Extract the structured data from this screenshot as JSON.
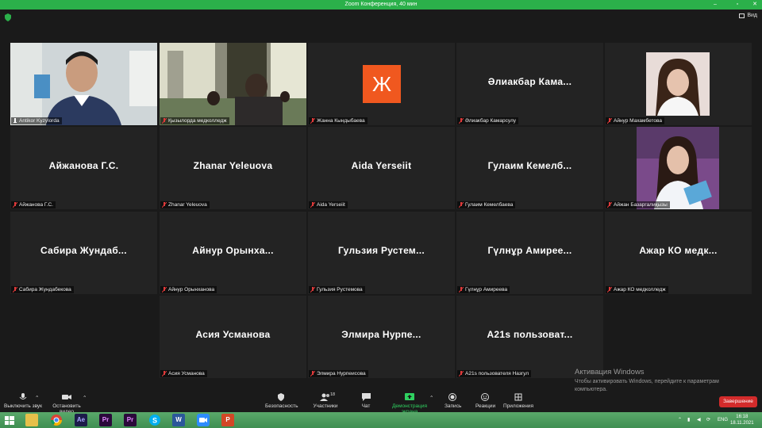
{
  "window": {
    "title": "Zoom Конференция, 40 мин",
    "view_label": "Вид"
  },
  "tiles": [
    {
      "name": "Antikor Kyzylorda",
      "big": ""
    },
    {
      "name": "Қызылорда медколледж",
      "big": ""
    },
    {
      "name": "Жанна Кындыбаева",
      "big": "",
      "logo": "Ж"
    },
    {
      "name": "Әлиакбар Камарсулу",
      "big": "Әлиакбар  Кама..."
    },
    {
      "name": "Айнур Махамбетова",
      "big": ""
    },
    {
      "name": "Айжанова Г.С.",
      "big": "Айжанова Г.С."
    },
    {
      "name": "Zhanar Yeleuova",
      "big": "Zhanar Yeleuova"
    },
    {
      "name": "Aida Yerseiit",
      "big": "Aida Yerseiit"
    },
    {
      "name": "Гулаим Кемелбаева",
      "big": "Гулаим  Кемелб..."
    },
    {
      "name": "Айжан Базаргалиқызы",
      "big": ""
    },
    {
      "name": "Сабира Жундабекова",
      "big": "Сабира  Жундаб..."
    },
    {
      "name": "Айнур Орынханова",
      "big": "Айнур  Орынха..."
    },
    {
      "name": "Гульзия Рустемова",
      "big": "Гульзия  Рустем..."
    },
    {
      "name": "Гүлнұр Амиреева",
      "big": "Гүлнұр  Амирее..."
    },
    {
      "name": "Ажар КО медколледж",
      "big": "Ажар КО  медк..."
    },
    {
      "name": "Асия Усманова",
      "big": "Асия Усманова"
    },
    {
      "name": "Элмира Нурпеисова",
      "big": "Элмира  Нурпе..."
    },
    {
      "name": "A21s пользователя Назгул",
      "big": "A21s  пользоват..."
    }
  ],
  "toolbar": {
    "mute": "Выключить звук",
    "stop_video": "Остановить видео",
    "security": "Безопасность",
    "participants": "Участники",
    "participants_count": "18",
    "chat": "Чат",
    "share": "Демонстрация экрана",
    "record": "Запись",
    "reactions": "Реакции",
    "apps": "Приложения",
    "end": "Завершение"
  },
  "activation": {
    "title": "Активация Windows",
    "line1": "Чтобы активировать Windows, перейдите к параметрам",
    "line2": "компьютера."
  },
  "taskbar": {
    "lang": "ENG",
    "time": "16:18",
    "date": "18.11.2021",
    "apps": [
      "Ae",
      "Pr",
      "Pr",
      "W",
      "P"
    ]
  },
  "colors": {
    "accent_green": "#2bb04a",
    "active_outline": "#b5e35a",
    "end_red": "#d32b2b",
    "logo_orange": "#f0581f"
  }
}
